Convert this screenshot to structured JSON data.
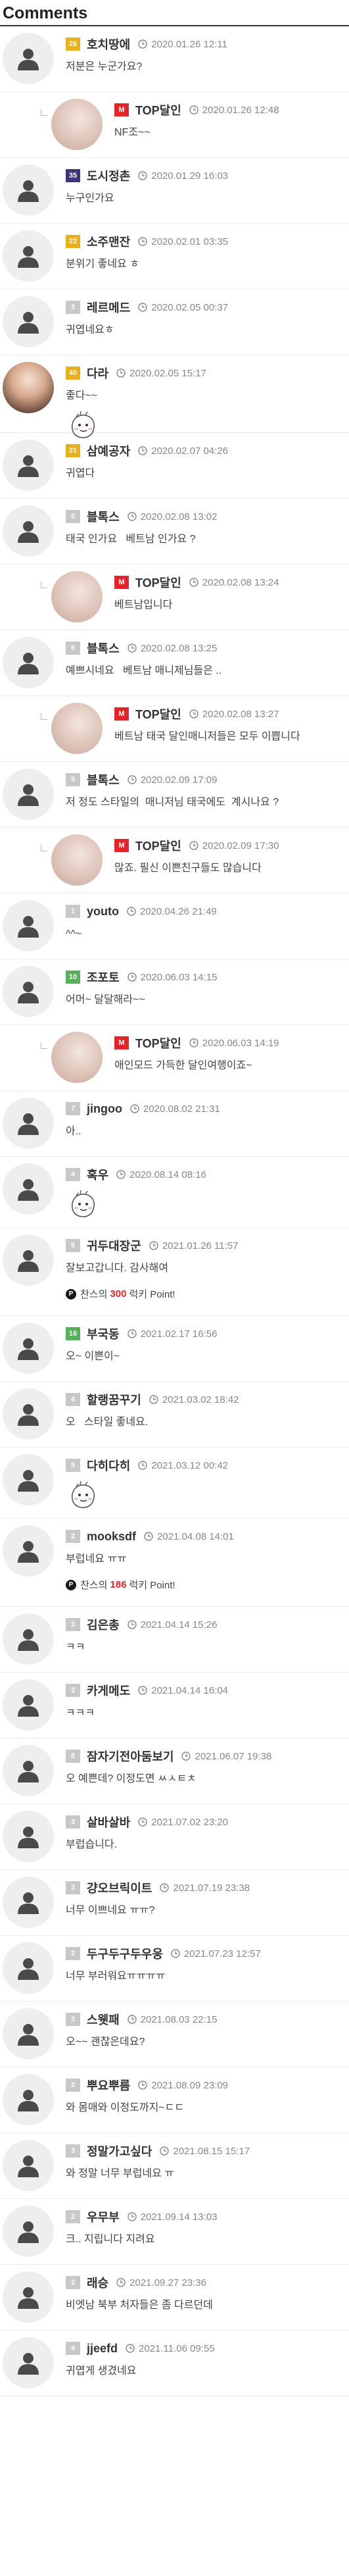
{
  "page": {
    "title": "Comments"
  },
  "comments": [
    {
      "level": 0,
      "avatar": "default",
      "lv": "26",
      "lv_color": "gold",
      "nick": "호치땅에",
      "date": "2020.01.26 12:11",
      "text": "저분은 누군가요?",
      "h": 100
    },
    {
      "level": 1,
      "avatar": "photo",
      "lv": "M",
      "lv_color": "m",
      "nick": "TOP달인",
      "date": "2020.01.26 12:48",
      "text": "NF조~~",
      "h": 100
    },
    {
      "level": 0,
      "avatar": "default",
      "lv": "35",
      "lv_color": "navy",
      "nick": "도시정촌",
      "date": "2020.01.29 16:03",
      "text": "누구인가요",
      "h": 100
    },
    {
      "level": 0,
      "avatar": "default",
      "lv": "22",
      "lv_color": "gold",
      "nick": "소주맨잔",
      "date": "2020.02.01 03:35",
      "text": "분위기 좋네요 ㅎ",
      "h": 100
    },
    {
      "level": 0,
      "avatar": "default",
      "lv": "3",
      "lv_color": "grey",
      "nick": "레르메드",
      "date": "2020.02.05 00:37",
      "text": "귀엽네요ㅎ",
      "h": 100
    },
    {
      "level": 0,
      "avatar": "photo2",
      "lv": "40",
      "lv_color": "gold",
      "nick": "다라",
      "date": "2020.02.05 15:17",
      "text": "좋다~~",
      "sticker": true,
      "h": 118
    },
    {
      "level": 0,
      "avatar": "default",
      "lv": "21",
      "lv_color": "gold",
      "nick": "삼예공자",
      "date": "2020.02.07 04:26",
      "text": "귀엽다",
      "h": 100
    },
    {
      "level": 0,
      "avatar": "default",
      "lv": "5",
      "lv_color": "grey",
      "nick": "블톡스",
      "date": "2020.02.08 13:02",
      "text": "태국 인가요   베트남 인가요 ?",
      "h": 100
    },
    {
      "level": 1,
      "avatar": "photo",
      "lv": "M",
      "lv_color": "m",
      "nick": "TOP달인",
      "date": "2020.02.08 13:24",
      "text": "베트남입니다",
      "h": 100
    },
    {
      "level": 0,
      "avatar": "default",
      "lv": "6",
      "lv_color": "grey",
      "nick": "블톡스",
      "date": "2020.02.08 13:25",
      "text": "예쁘시네요   베트남 매니제님들은 ..",
      "h": 100
    },
    {
      "level": 1,
      "avatar": "photo",
      "lv": "M",
      "lv_color": "m",
      "nick": "TOP달인",
      "date": "2020.02.08 13:27",
      "text": "베트남 태국 달인매니저들은 모두 이쁩니다",
      "h": 100
    },
    {
      "level": 0,
      "avatar": "default",
      "lv": "5",
      "lv_color": "grey",
      "nick": "블톡스",
      "date": "2020.02.09 17:09",
      "text": "저 정도 스타일의  매니저님 태국에도  계시나요 ?",
      "h": 100
    },
    {
      "level": 1,
      "avatar": "photo",
      "lv": "M",
      "lv_color": "m",
      "nick": "TOP달인",
      "date": "2020.02.09 17:30",
      "text": "많죠. 필신 이쁜친구들도 많습니다",
      "h": 100
    },
    {
      "level": 0,
      "avatar": "default",
      "lv": "1",
      "lv_color": "grey",
      "nick": "youto",
      "date": "2020.04.26 21:49",
      "text": "^^~",
      "h": 100
    },
    {
      "level": 0,
      "avatar": "default",
      "lv": "10",
      "lv_color": "green",
      "nick": "조포토",
      "date": "2020.06.03 14:15",
      "text": "어머~ 달달해라~~",
      "h": 100
    },
    {
      "level": 1,
      "avatar": "photo",
      "lv": "M",
      "lv_color": "m",
      "nick": "TOP달인",
      "date": "2020.06.03 14:19",
      "text": "애인모드 가득한 달인여행이죠~",
      "h": 100
    },
    {
      "level": 0,
      "avatar": "default",
      "lv": "7",
      "lv_color": "grey",
      "nick": "jingoo",
      "date": "2020.08.02 21:31",
      "text": "아..",
      "h": 100
    },
    {
      "level": 0,
      "avatar": "default",
      "lv": "4",
      "lv_color": "grey",
      "nick": "혹우",
      "date": "2020.08.14 08:16",
      "text": "",
      "sticker": true,
      "h": 108
    },
    {
      "level": 0,
      "avatar": "default",
      "lv": "5",
      "lv_color": "grey",
      "nick": "귀두대장군",
      "date": "2021.01.26 11:57",
      "text": "잘보고갑니다. 감사해여",
      "point_pre": "찬스의",
      "point_amt": "300",
      "point_post": "럭키 Point!",
      "h": 134
    },
    {
      "level": 0,
      "avatar": "default",
      "lv": "16",
      "lv_color": "green",
      "nick": "부국동",
      "date": "2021.02.17 16:56",
      "text": "오~ 이쁜이~",
      "h": 100
    },
    {
      "level": 0,
      "avatar": "default",
      "lv": "4",
      "lv_color": "grey",
      "nick": "할랭꿈꾸기",
      "date": "2021.03.02 18:42",
      "text": "오   스타일 좋네요.",
      "h": 100
    },
    {
      "level": 0,
      "avatar": "default",
      "lv": "5",
      "lv_color": "grey",
      "nick": "다히다히",
      "date": "2021.03.12 00:42",
      "text": "",
      "sticker": true,
      "h": 108
    },
    {
      "level": 0,
      "avatar": "default",
      "lv": "2",
      "lv_color": "grey",
      "nick": "mooksdf",
      "date": "2021.04.08 14:01",
      "text": "부럽네요 ㅠㅠ",
      "point_pre": "찬스의",
      "point_amt": "186",
      "point_post": "럭키 Point!",
      "h": 134
    },
    {
      "level": 0,
      "avatar": "default",
      "lv": "3",
      "lv_color": "grey",
      "nick": "김은총",
      "date": "2021.04.14 15:26",
      "text": "ㅋㅋ",
      "h": 100
    },
    {
      "level": 0,
      "avatar": "default",
      "lv": "2",
      "lv_color": "grey",
      "nick": "카게메도",
      "date": "2021.04.14 16:04",
      "text": "ㅋㅋㅋ",
      "h": 100
    },
    {
      "level": 0,
      "avatar": "default",
      "lv": "5",
      "lv_color": "grey",
      "nick": "잠자기전아둠보기",
      "date": "2021.06.07 19:38",
      "text": "오 예쁜데? 이정도면 ㅆㅅㅌㅊ",
      "h": 100
    },
    {
      "level": 0,
      "avatar": "default",
      "lv": "3",
      "lv_color": "grey",
      "nick": "살바살바",
      "date": "2021.07.02 23:20",
      "text": "부럽습니다.",
      "h": 100
    },
    {
      "level": 0,
      "avatar": "default",
      "lv": "3",
      "lv_color": "grey",
      "nick": "걍오브릭이트",
      "date": "2021.07.19 23:38",
      "text": "너무 이쁘네요 ㅠㅠ?",
      "h": 100
    },
    {
      "level": 0,
      "avatar": "default",
      "lv": "2",
      "lv_color": "grey",
      "nick": "두구두구두우웅",
      "date": "2021.07.23 12:57",
      "text": "너무 부러워요ㅠㅠㅠㅠ",
      "h": 100
    },
    {
      "level": 0,
      "avatar": "default",
      "lv": "3",
      "lv_color": "grey",
      "nick": "스웻패",
      "date": "2021.08.03 22:15",
      "text": "오~~ 괜찮은데요?",
      "h": 100
    },
    {
      "level": 0,
      "avatar": "default",
      "lv": "2",
      "lv_color": "grey",
      "nick": "뿌요뿌름",
      "date": "2021.08.09 23:09",
      "text": "와 몸매와 이정도까지~ㄷㄷ",
      "h": 100
    },
    {
      "level": 0,
      "avatar": "default",
      "lv": "3",
      "lv_color": "grey",
      "nick": "정말가고싶다",
      "date": "2021.08.15 15:17",
      "text": "와 정말 너무 부럽네요 ㅠ",
      "h": 100
    },
    {
      "level": 0,
      "avatar": "default",
      "lv": "2",
      "lv_color": "grey",
      "nick": "우무부",
      "date": "2021.09.14 13:03",
      "text": "크.. 지립니다 지려요",
      "h": 100
    },
    {
      "level": 0,
      "avatar": "default",
      "lv": "2",
      "lv_color": "grey",
      "nick": "래승",
      "date": "2021.09.27 23:36",
      "text": "비엣남 북부 처자들은 좀 다르던데",
      "h": 100
    },
    {
      "level": 0,
      "avatar": "default",
      "lv": "4",
      "lv_color": "grey",
      "nick": "jjeefd",
      "date": "2021.11.06 09:55",
      "text": "귀엽게 생겼네요",
      "h": 100
    }
  ]
}
